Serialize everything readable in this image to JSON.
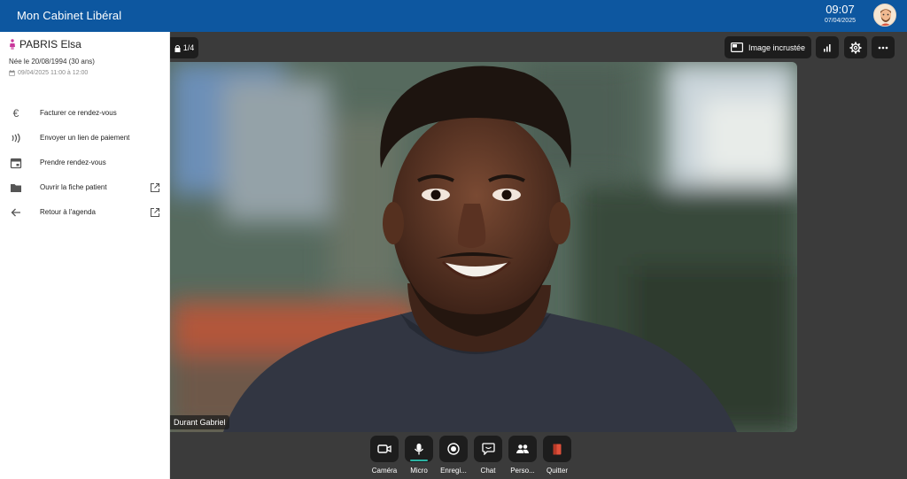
{
  "header": {
    "app_title": "Mon Cabinet Libéral",
    "time": "09:07",
    "date": "07/04/2025"
  },
  "patient": {
    "name": "PABRIS Elsa",
    "dob": "Née le 20/08/1994 (30 ans)",
    "appointment": "09/04/2025 11:00 à 12:00"
  },
  "menu": [
    {
      "label": "Facturer ce rendez-vous",
      "icon": "euro-icon"
    },
    {
      "label": "Envoyer un lien de paiement",
      "icon": "contactless-icon"
    },
    {
      "label": "Prendre rendez-vous",
      "icon": "calendar-icon"
    },
    {
      "label": "Ouvrir la fiche patient",
      "icon": "folder-icon",
      "external": true
    },
    {
      "label": "Retour à l'agenda",
      "icon": "arrow-left-icon",
      "external": true
    }
  ],
  "video": {
    "participant_counter": "1/4",
    "pip_label": "Image incrustée",
    "participant_name": "Durant Gabriel"
  },
  "controls": [
    {
      "label": "Caméra",
      "icon": "camera-icon"
    },
    {
      "label": "Micro",
      "icon": "microphone-icon"
    },
    {
      "label": "Enregi...",
      "icon": "record-icon"
    },
    {
      "label": "Chat",
      "icon": "chat-icon"
    },
    {
      "label": "Perso...",
      "icon": "people-icon"
    },
    {
      "label": "Quitter",
      "icon": "quit-icon"
    }
  ],
  "colors": {
    "header_bg": "#0d57a0",
    "stage_bg": "#3b3b3b",
    "button_bg": "#1d1d1d",
    "quit_red": "#e0503a",
    "active_accent": "#2bb3a3",
    "patient_pin": "#c9379a"
  }
}
